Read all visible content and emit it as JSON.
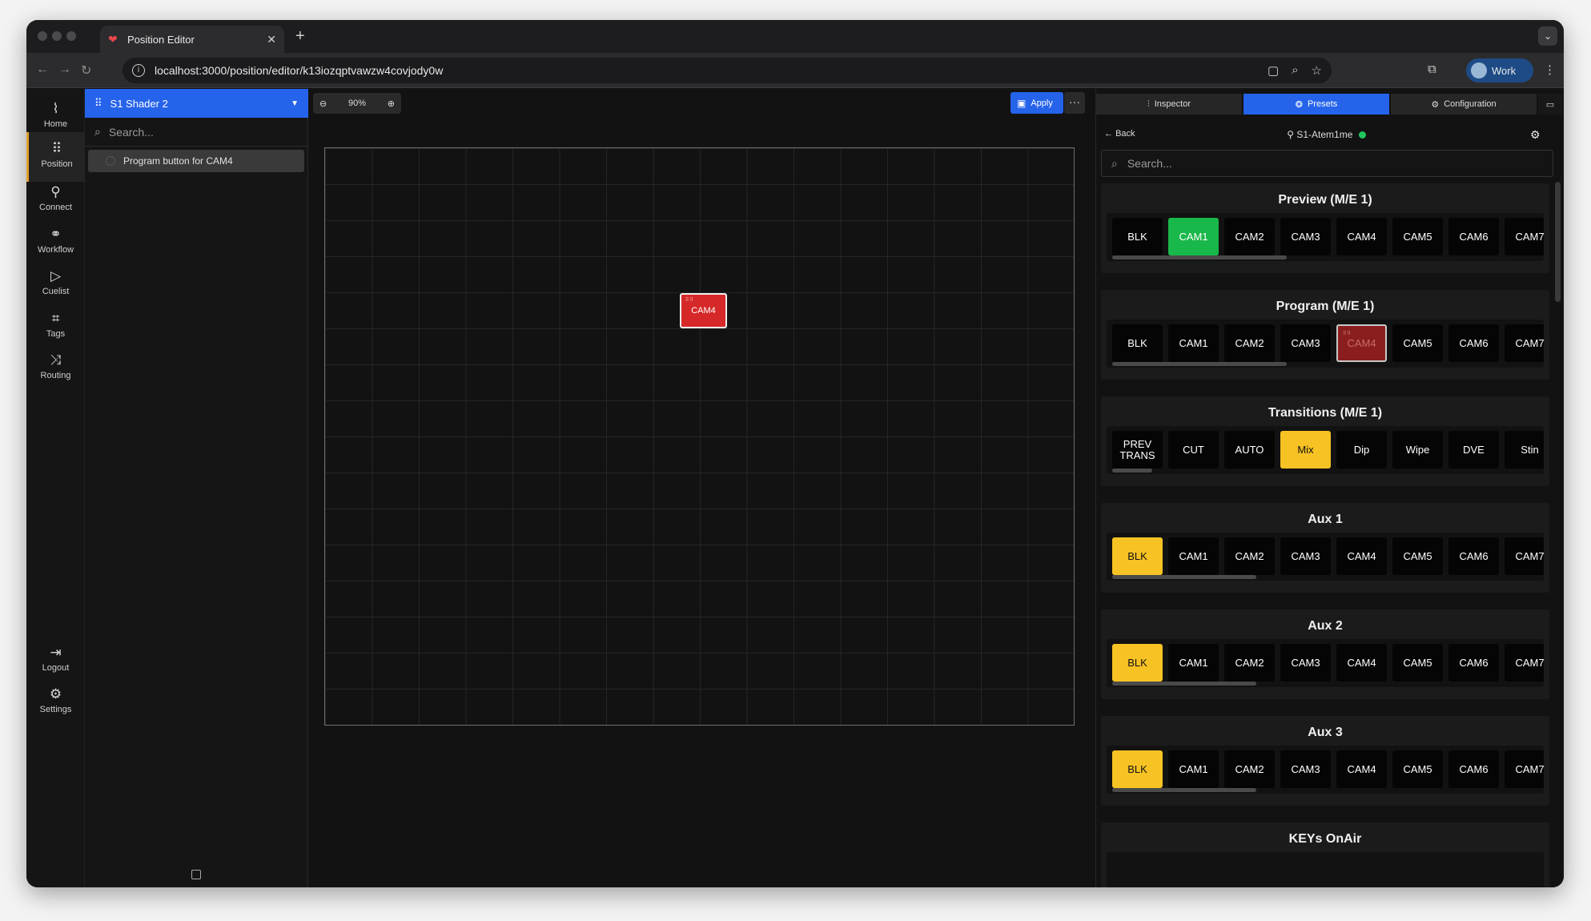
{
  "browser": {
    "tab_title": "Position Editor",
    "url": "localhost:3000/position/editor/k13iozqptvawzw4covjody0w",
    "profile_label": "Work"
  },
  "rail": {
    "items": [
      {
        "label": "Home",
        "icon": "activity-icon"
      },
      {
        "label": "Position",
        "icon": "grid-icon"
      },
      {
        "label": "Connect",
        "icon": "plug-icon"
      },
      {
        "label": "Workflow",
        "icon": "workflow-icon"
      },
      {
        "label": "Cuelist",
        "icon": "play-icon"
      },
      {
        "label": "Tags",
        "icon": "tag-icon"
      },
      {
        "label": "Routing",
        "icon": "shuffle-icon"
      }
    ],
    "bottom": [
      {
        "label": "Logout",
        "icon": "logout-icon"
      },
      {
        "label": "Settings",
        "icon": "settings-icon"
      }
    ],
    "active": "Position"
  },
  "left_panel": {
    "title": "S1 Shader 2",
    "search_placeholder": "Search...",
    "items": [
      "Program button for CAM4"
    ]
  },
  "canvas": {
    "zoom": "90%",
    "apply_label": "Apply",
    "tile_label": "CAM4"
  },
  "right_panel": {
    "tabs": [
      "Inspector",
      "Presets",
      "Configuration"
    ],
    "active_tab": "Presets",
    "back_label": "Back",
    "connection": "S1-Atem1me",
    "search_placeholder": "Search...",
    "groups": [
      {
        "title": "Preview (M/E 1)",
        "buttons": [
          "BLK",
          "CAM1",
          "CAM2",
          "CAM3",
          "CAM4",
          "CAM5",
          "CAM6",
          "CAM7"
        ],
        "highlight": {
          "CAM1": "green"
        }
      },
      {
        "title": "Program (M/E 1)",
        "buttons": [
          "BLK",
          "CAM1",
          "CAM2",
          "CAM3",
          "CAM4",
          "CAM5",
          "CAM6",
          "CAM7"
        ],
        "highlight": {
          "CAM4": "red"
        }
      },
      {
        "title": "Transitions (M/E 1)",
        "buttons": [
          "PREV TRANS",
          "CUT",
          "AUTO",
          "Mix",
          "Dip",
          "Wipe",
          "DVE",
          "Stin"
        ],
        "highlight": {
          "Mix": "yellow"
        }
      },
      {
        "title": "Aux 1",
        "buttons": [
          "BLK",
          "CAM1",
          "CAM2",
          "CAM3",
          "CAM4",
          "CAM5",
          "CAM6",
          "CAM7"
        ],
        "highlight": {
          "BLK": "yellow"
        }
      },
      {
        "title": "Aux 2",
        "buttons": [
          "BLK",
          "CAM1",
          "CAM2",
          "CAM3",
          "CAM4",
          "CAM5",
          "CAM6",
          "CAM7"
        ],
        "highlight": {
          "BLK": "yellow"
        }
      },
      {
        "title": "Aux 3",
        "buttons": [
          "BLK",
          "CAM1",
          "CAM2",
          "CAM3",
          "CAM4",
          "CAM5",
          "CAM6",
          "CAM7"
        ],
        "highlight": {
          "BLK": "yellow"
        }
      },
      {
        "title": "KEYs OnAir",
        "buttons": [],
        "highlight": {}
      }
    ]
  },
  "colors": {
    "accent_blue": "#2563eb",
    "on_air_green": "#19b84a",
    "program_red": "#d62828",
    "selected_yellow": "#f7c223"
  }
}
